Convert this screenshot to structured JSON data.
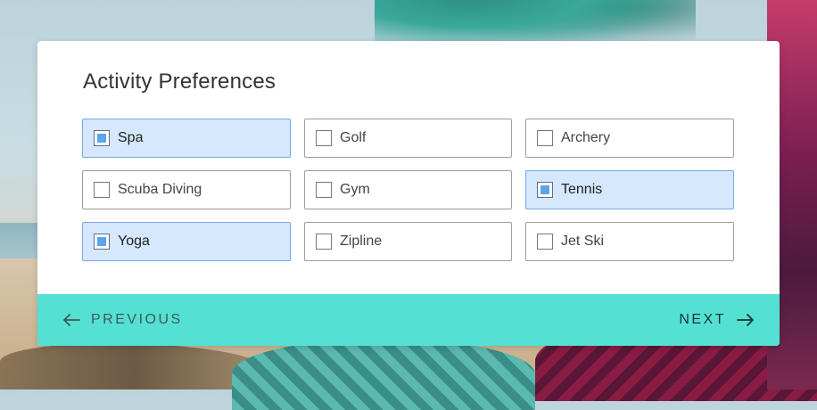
{
  "form": {
    "title": "Activity Preferences",
    "options": [
      {
        "label": "Spa",
        "checked": true
      },
      {
        "label": "Golf",
        "checked": false
      },
      {
        "label": "Archery",
        "checked": false
      },
      {
        "label": "Scuba Diving",
        "checked": false
      },
      {
        "label": "Gym",
        "checked": false
      },
      {
        "label": "Tennis",
        "checked": true
      },
      {
        "label": "Yoga",
        "checked": true
      },
      {
        "label": "Zipline",
        "checked": false
      },
      {
        "label": "Jet Ski",
        "checked": false
      }
    ]
  },
  "footer": {
    "previous_label": "PREVIOUS",
    "next_label": "NEXT",
    "previous_icon": "arrow-left-icon",
    "next_icon": "arrow-right-icon"
  },
  "colors": {
    "footer_bg": "#55e0d4",
    "checked_bg": "#d6e8fd",
    "checked_border": "#74a8e6",
    "check_fill": "#5aa5f0"
  }
}
